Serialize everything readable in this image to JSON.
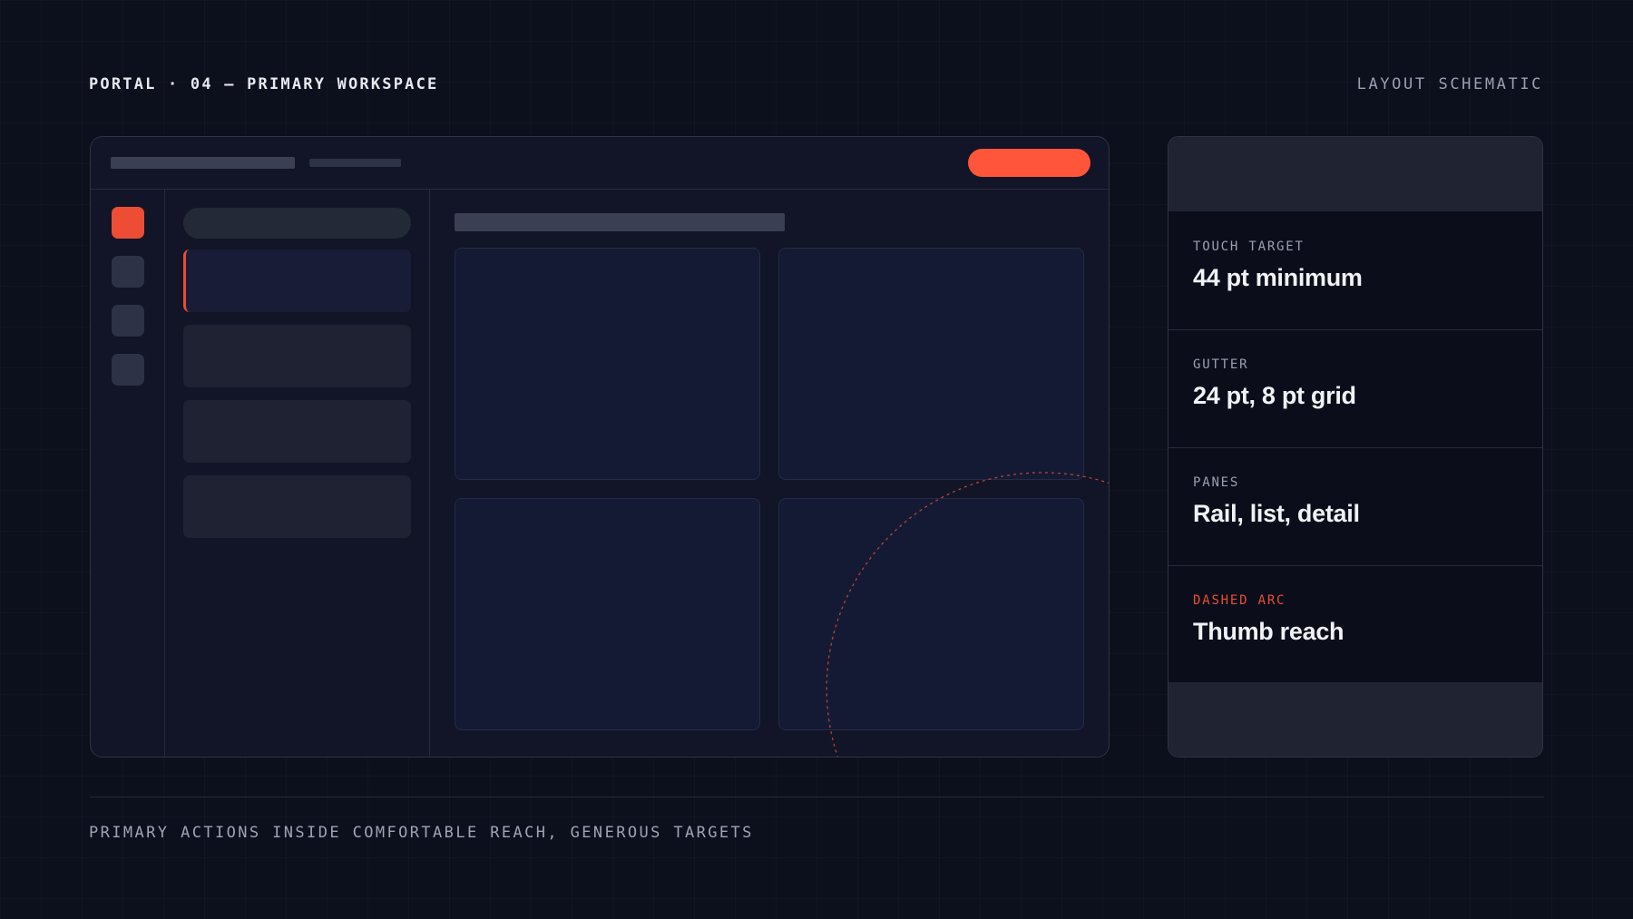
{
  "header": {
    "left_title": "PORTAL · 04 — PRIMARY WORKSPACE",
    "right_title": "LAYOUT SCHEMATIC"
  },
  "colors": {
    "accent": "#ff553a",
    "background": "#0c0f1c",
    "panel": "#111527",
    "card": "#151a34",
    "text": "#f1f2f6",
    "muted": "#9aa0b4"
  },
  "mockup": {
    "rail_buttons": 4,
    "active_rail_index": 0,
    "list_items": 4,
    "selected_list_index": 0,
    "detail_cards": 4
  },
  "specs": [
    {
      "label": "TOUCH TARGET",
      "value": "44 pt minimum",
      "accent": false
    },
    {
      "label": "GUTTER",
      "value": "24 pt, 8 pt grid",
      "accent": false
    },
    {
      "label": "PANES",
      "value": "Rail, list, detail",
      "accent": false
    },
    {
      "label": "DASHED ARC",
      "value": "Thumb reach",
      "accent": true
    }
  ],
  "footer": {
    "caption": "PRIMARY ACTIONS INSIDE COMFORTABLE REACH, GENEROUS TARGETS"
  }
}
